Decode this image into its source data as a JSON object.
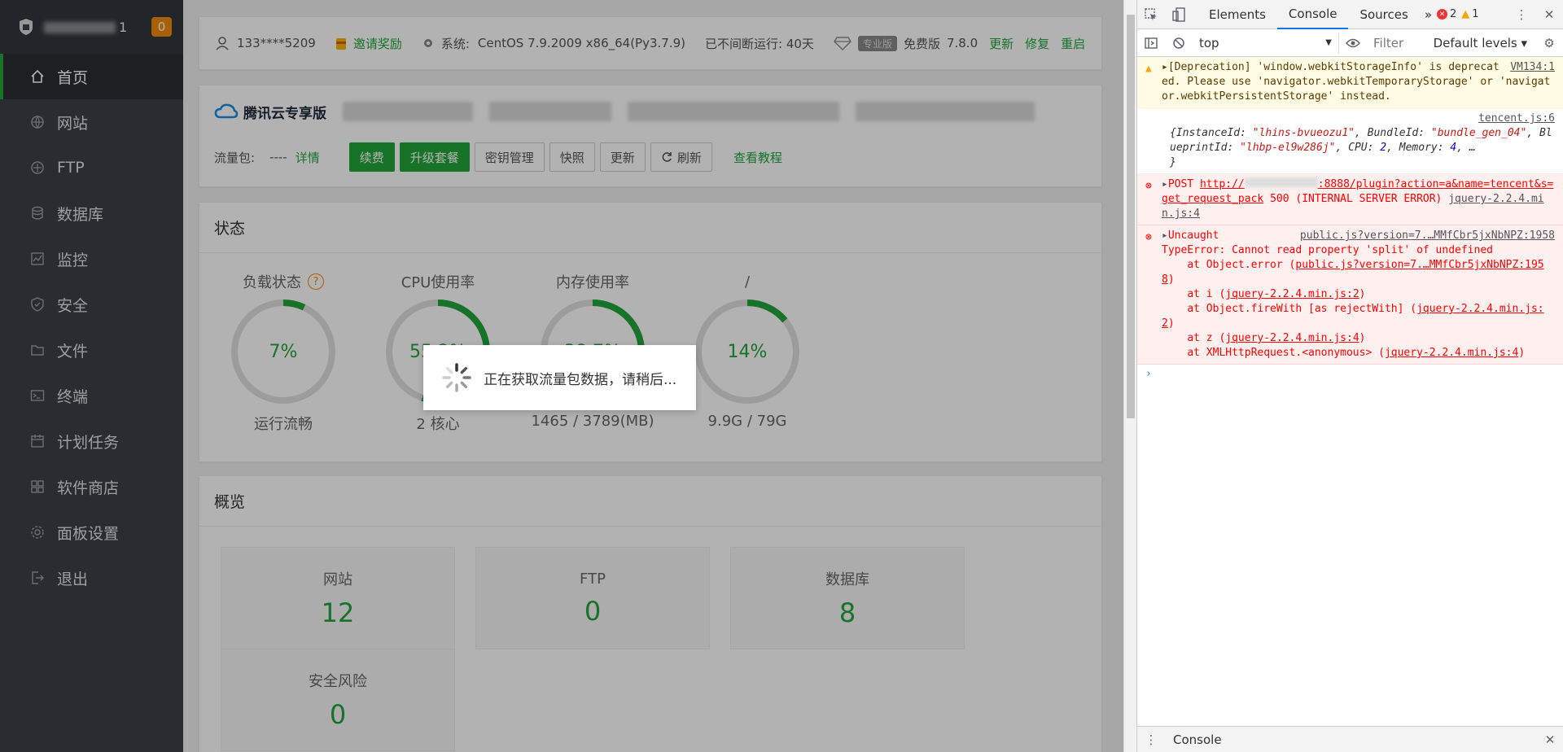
{
  "sidebar": {
    "title_suffix": "1",
    "badge": "0",
    "items": [
      {
        "label": "首页",
        "icon": "home-icon"
      },
      {
        "label": "网站",
        "icon": "globe-icon"
      },
      {
        "label": "FTP",
        "icon": "ftp-icon"
      },
      {
        "label": "数据库",
        "icon": "database-icon"
      },
      {
        "label": "监控",
        "icon": "monitor-icon"
      },
      {
        "label": "安全",
        "icon": "shield-icon"
      },
      {
        "label": "文件",
        "icon": "folder-icon"
      },
      {
        "label": "终端",
        "icon": "terminal-icon"
      },
      {
        "label": "计划任务",
        "icon": "calendar-icon"
      },
      {
        "label": "软件商店",
        "icon": "apps-icon"
      },
      {
        "label": "面板设置",
        "icon": "gear-icon"
      },
      {
        "label": "退出",
        "icon": "logout-icon"
      }
    ]
  },
  "topbar": {
    "user": "133****5209",
    "invite": "邀请奖励",
    "system_label": "系统:",
    "system_value": "CentOS 7.9.2009 x86_64(Py3.7.9)",
    "uptime": "已不间断运行: 40天",
    "pro_tag": "专业版",
    "edition": "免费版",
    "version": "7.8.0",
    "update": "更新",
    "repair": "修复",
    "restart": "重启"
  },
  "tencent": {
    "brand": "腾讯云专享版",
    "traffic_label": "流量包:",
    "traffic_value": "----",
    "detail": "详情",
    "buttons": [
      "续费",
      "升级套餐",
      "密钥管理",
      "快照",
      "更新",
      "刷新"
    ],
    "tutorial": "查看教程"
  },
  "status": {
    "title": "状态",
    "gauges": [
      {
        "title": "负载状态",
        "value": "7%",
        "foot": "运行流畅",
        "percent": 7,
        "help": "?"
      },
      {
        "title": "CPU使用率",
        "value": "55.2%",
        "foot": "2 核心",
        "percent": 55.2
      },
      {
        "title": "内存使用率",
        "value": "38.7%",
        "foot": "1465 / 3789(MB)",
        "percent": 38.7
      },
      {
        "title": "/",
        "value": "14%",
        "foot": "9.9G / 79G",
        "percent": 14
      }
    ]
  },
  "overview": {
    "title": "概览",
    "items": [
      {
        "label": "网站",
        "value": "12"
      },
      {
        "label": "FTP",
        "value": "0"
      },
      {
        "label": "数据库",
        "value": "8"
      },
      {
        "label": "安全风险",
        "value": "0"
      }
    ]
  },
  "loading": {
    "text": "正在获取流量包数据，请稍后..."
  },
  "devtools": {
    "tabs": [
      "Elements",
      "Console",
      "Sources"
    ],
    "more": "»",
    "error_count": "2",
    "warn_count": "1",
    "context": "top",
    "filter": "Filter",
    "levels": "Default levels",
    "drawer_tab": "Console",
    "messages": {
      "warn_text": "[Deprecation] 'window.webkitStorageInfo' is deprecated. Please use 'navigator.webkitTemporaryStorage' or 'navigator.webkitPersistentStorage' instead.",
      "warn_src": "VM134:1",
      "log_src": "tencent.js:6",
      "log_1": "{InstanceId: ",
      "log_2": "\"lhins-bvueozu1\"",
      "log_3": ", BundleId: ",
      "log_4": "\"bundle_gen_04\"",
      "log_5": ", BlueprintId: ",
      "log_6": "\"lhbp-el9w286j\"",
      "log_7": ", CPU: ",
      "log_8": "2",
      "log_9": ", Memory: ",
      "log_10": "4",
      "log_11": ", …",
      "log_close": "}",
      "post_method": "POST",
      "post_url_a": "http://",
      "post_url_b": ":8888/plugin?action=a&name=tencent&s=get_request_pack",
      "post_status": "500 (INTERNAL SERVER ERROR)",
      "post_src": "jquery-2.2.4.min.js:4",
      "uncaught": "Uncaught",
      "uncaught_src": "public.js?version=7.…MMfCbr5jxNbNPZ:1958",
      "type_error": "TypeError: Cannot read property 'split' of undefined",
      "st1_a": "    at Object.error (",
      "st1_b": "public.js?version=7.…MMfCbr5jxNbNPZ:1958",
      "st2_a": "    at i (",
      "st2_b": "jquery-2.2.4.min.js:2",
      "st3_a": "    at Object.fireWith [as rejectWith] (",
      "st3_b": "jquery-2.2.4.min.js:2",
      "st4_a": "    at z (",
      "st4_b": "jquery-2.2.4.min.js:4",
      "st5_a": "    at XMLHttpRequest.<anonymous> (",
      "st5_b": "jquery-2.2.4.min.js:4",
      "close_paren": ")",
      "prompt": "›"
    }
  },
  "colors": {
    "accent": "#20a53a",
    "sidebar": "#3b3f45",
    "badge": "#f28a00",
    "error": "#ff0000"
  }
}
